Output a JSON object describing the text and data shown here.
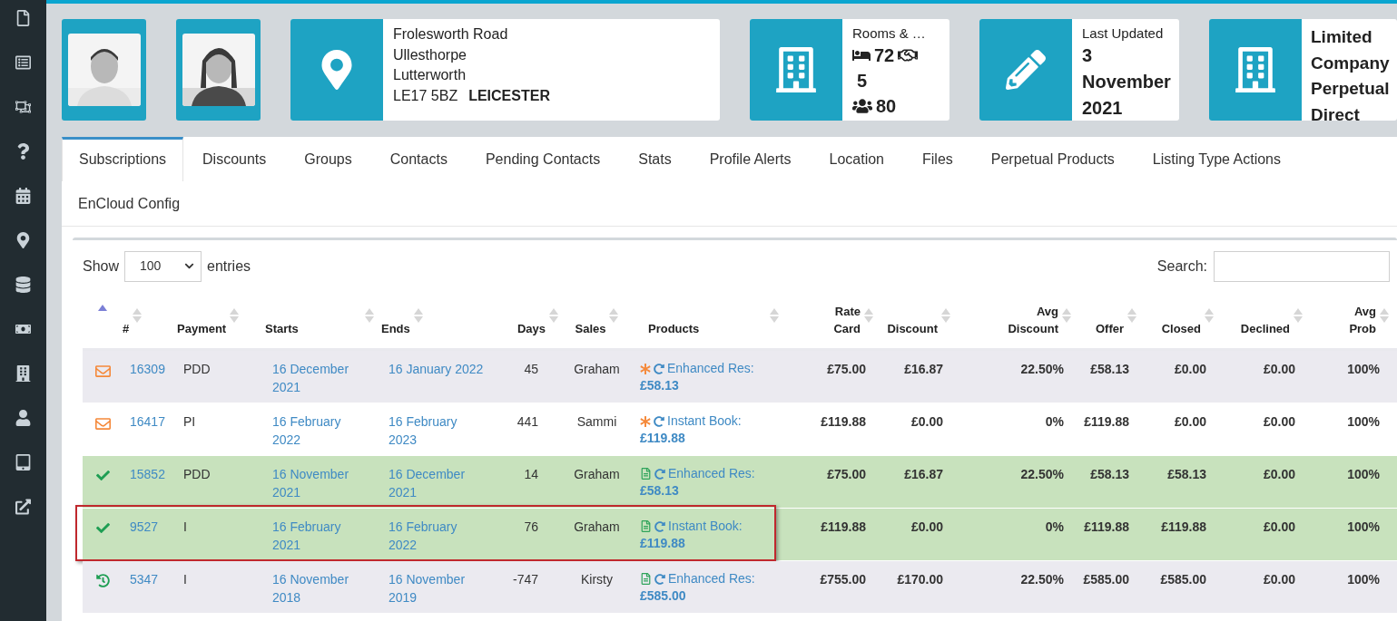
{
  "header": {
    "address": {
      "lines": [
        "Frolesworth Road",
        "Ullesthorpe",
        "Lutterworth"
      ],
      "postcode": "LE17 5BZ",
      "city": "LEICESTER"
    },
    "rooms": {
      "title": "Rooms & …",
      "beds": "72",
      "partners": "5",
      "guests": "80"
    },
    "updated": {
      "label": "Last Updated",
      "date": "3 November 2021"
    },
    "company": {
      "text": "Limited Company Perpetual Direct"
    }
  },
  "tabs": [
    {
      "label": "Subscriptions",
      "selected": true
    },
    {
      "label": "Discounts",
      "selected": false
    },
    {
      "label": "Groups",
      "selected": false
    },
    {
      "label": "Contacts",
      "selected": false
    },
    {
      "label": "Pending Contacts",
      "selected": false
    },
    {
      "label": "Stats",
      "selected": false
    },
    {
      "label": "Profile Alerts",
      "selected": false
    },
    {
      "label": "Location",
      "selected": false
    },
    {
      "label": "Files",
      "selected": false
    },
    {
      "label": "Perpetual Products",
      "selected": false
    },
    {
      "label": "Listing Type Actions",
      "selected": false
    },
    {
      "label": "EnCloud Config",
      "selected": false
    }
  ],
  "table": {
    "show_label": "Show",
    "page_size": "100",
    "entries_label": "entries",
    "search_label": "Search:",
    "columns": [
      {
        "sorted": true
      },
      {
        "label": "#",
        "sorted": false
      },
      {
        "label": "Payment",
        "sorted": false
      },
      {
        "label": "Starts",
        "sorted": false
      },
      {
        "label": "Ends",
        "sorted": false
      },
      {
        "label": "Days",
        "sorted": false
      },
      {
        "label": "Sales",
        "sorted": false
      },
      {
        "label": "Products",
        "sorted": false
      },
      {
        "label": "Rate Card",
        "sorted": false
      },
      {
        "label": "Discount",
        "sorted": false
      },
      {
        "label": "Avg Discount",
        "sorted": false
      },
      {
        "label": "Offer",
        "sorted": false
      },
      {
        "label": "Closed",
        "sorted": false
      },
      {
        "label": "Declined",
        "sorted": false
      },
      {
        "label": "Avg Prob",
        "sorted": false
      }
    ],
    "rows": [
      {
        "success": false,
        "outlined": false,
        "kind": "envelope",
        "id": "16309",
        "payment": "PDD",
        "starts": "16 December 2021",
        "ends": "16 January 2022",
        "days": "45",
        "sales": "Graham",
        "product": {
          "kind": "asterisk",
          "label": "Enhanced Res:",
          "price": "£58.13"
        },
        "rate_card": "£75.00",
        "discount": "£16.87",
        "avg_discount": "22.50%",
        "offer": "£58.13",
        "closed": "£0.00",
        "declined": "£0.00",
        "avg_prob": "100%"
      },
      {
        "success": false,
        "outlined": false,
        "kind": "envelope",
        "id": "16417",
        "payment": "PI",
        "starts": "16 February 2022",
        "ends": "16 February 2023",
        "days": "441",
        "sales": "Sammi",
        "product": {
          "kind": "asterisk",
          "label": "Instant Book:",
          "price": "£119.88"
        },
        "rate_card": "£119.88",
        "discount": "£0.00",
        "avg_discount": "0%",
        "offer": "£119.88",
        "closed": "£0.00",
        "declined": "£0.00",
        "avg_prob": "100%"
      },
      {
        "success": true,
        "outlined": false,
        "kind": "check",
        "id": "15852",
        "payment": "PDD",
        "starts": "16 November 2021",
        "ends": "16 December 2021",
        "days": "14",
        "sales": "Graham",
        "product": {
          "kind": "document",
          "label": "Enhanced Res:",
          "price": "£58.13"
        },
        "rate_card": "£75.00",
        "discount": "£16.87",
        "avg_discount": "22.50%",
        "offer": "£58.13",
        "closed": "£58.13",
        "declined": "£0.00",
        "avg_prob": "100%"
      },
      {
        "success": true,
        "outlined": true,
        "kind": "check",
        "id": "9527",
        "payment": "I",
        "starts": "16 February 2021",
        "ends": "16 February 2022",
        "days": "76",
        "sales": "Graham",
        "product": {
          "kind": "document",
          "label": "Instant Book:",
          "price": "£119.88"
        },
        "rate_card": "£119.88",
        "discount": "£0.00",
        "avg_discount": "0%",
        "offer": "£119.88",
        "closed": "£119.88",
        "declined": "£0.00",
        "avg_prob": "100%"
      },
      {
        "success": false,
        "outlined": false,
        "kind": "history",
        "id": "5347",
        "payment": "I",
        "starts": "16 November 2018",
        "ends": "16 November 2019",
        "days": "-747",
        "sales": "Kirsty",
        "product": {
          "kind": "document",
          "label": "Enhanced Res:",
          "price": "£585.00"
        },
        "rate_card": "£755.00",
        "discount": "£170.00",
        "avg_discount": "22.50%",
        "offer": "£585.00",
        "closed": "£585.00",
        "declined": "£0.00",
        "avg_prob": "100%"
      }
    ]
  }
}
